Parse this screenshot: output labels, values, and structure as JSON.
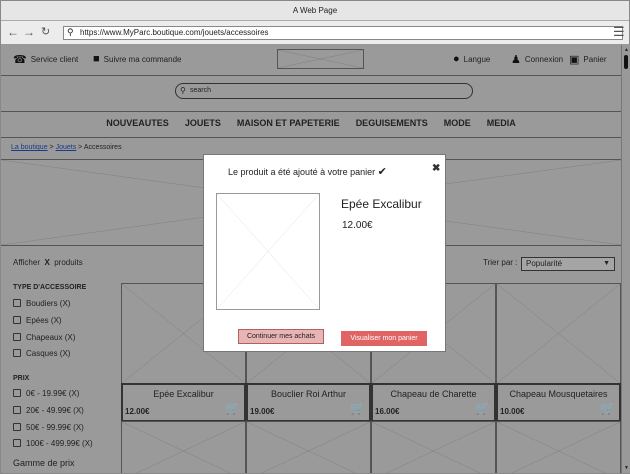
{
  "browser": {
    "title": "A Web Page",
    "url": "https://www.MyParc.boutique.com/jouets/accessoires"
  },
  "header": {
    "service_client": "Service client",
    "suivre": "Suivre ma commande",
    "langue": "Langue",
    "connexion": "Connexion",
    "panier": "Panier"
  },
  "search": {
    "placeholder": "search"
  },
  "menu": [
    "NOUVEAUTES",
    "JOUETS",
    "MAISON ET PAPETERIE",
    "DEGUISEMENTS",
    "MODE",
    "MEDIA"
  ],
  "breadcrumb": {
    "home": "La boutique",
    "cat": "Jouets",
    "current": "Accessoires",
    "sep": ">"
  },
  "filter": {
    "afficher": "Afficher",
    "x": "X",
    "produits": "produits",
    "trier": "Trier par :",
    "sort_value": "Popularité"
  },
  "sidebar": {
    "type_title": "TYPE D'ACCESSOIRE",
    "types": [
      "Boudiers  (X)",
      "Epées  (X)",
      "Chapeaux  (X)",
      "Casques  (X)"
    ],
    "prix_title": "PRIX",
    "prix": [
      "0€ - 19.99€  (X)",
      "20€ - 49.99€  (X)",
      "50€ - 99.99€  (X)",
      "100€ - 499.99€  (X)"
    ],
    "gamme": "Gamme de prix"
  },
  "products": [
    {
      "name": "Epée Excalibur",
      "price": "12.00€"
    },
    {
      "name": "Bouclier Roi Arthur",
      "price": "19.00€"
    },
    {
      "name": "Chapeau de Charette",
      "price": "16.00€"
    },
    {
      "name": "Chapeau Mousquetaires",
      "price": "10.00€"
    }
  ],
  "modal": {
    "message": "Le produit a été ajouté à votre panier",
    "product": "Epée Excalibur",
    "price": "12.00€",
    "continue": "Continuer mes achats",
    "view_cart": "Visualiser mon panier"
  },
  "colors": {
    "continue_bg": "#e8b4b4",
    "view_bg": "#e06464",
    "overlay": "#9a9a9a"
  }
}
